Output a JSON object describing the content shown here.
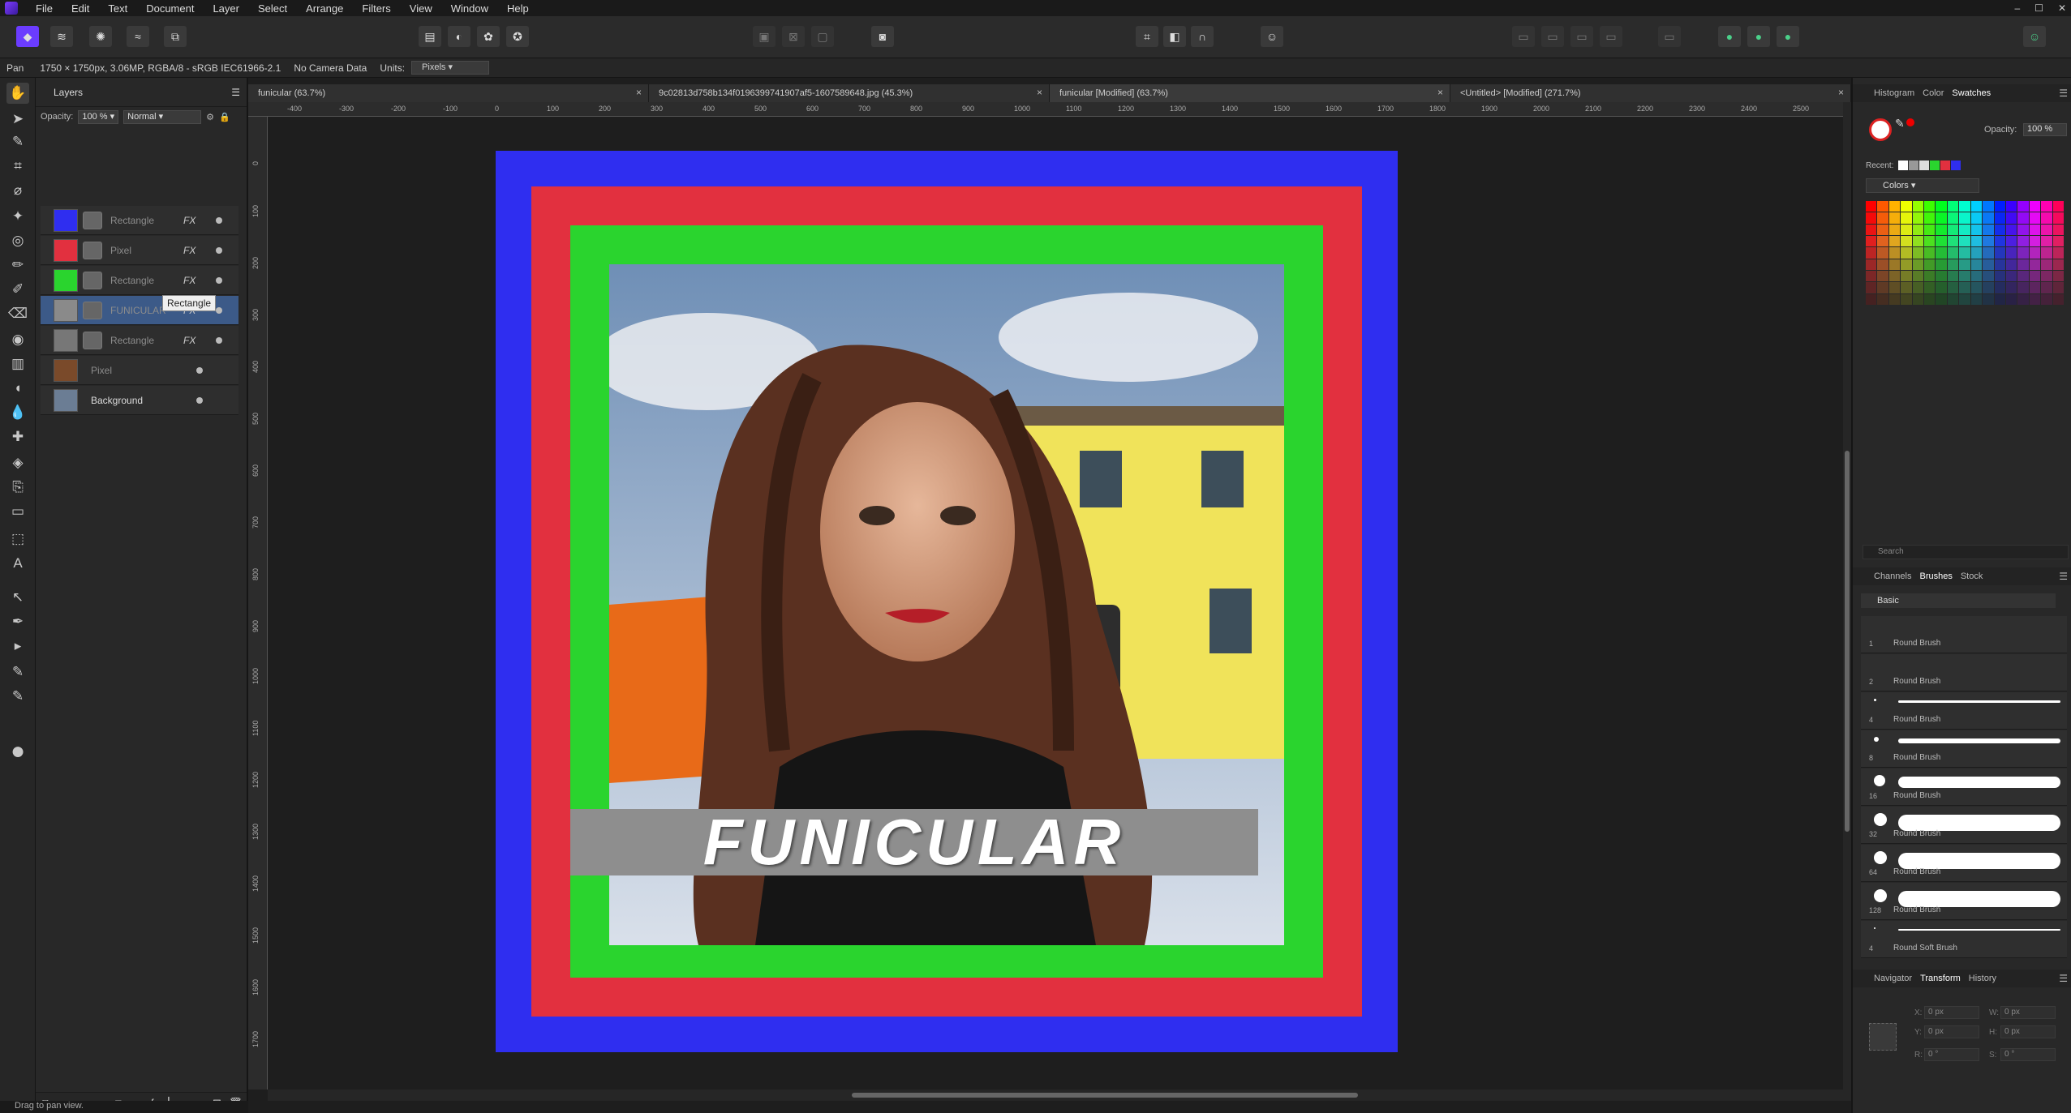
{
  "menubar": {
    "items": [
      "File",
      "Edit",
      "Text",
      "Document",
      "Layer",
      "Select",
      "Arrange",
      "Filters",
      "View",
      "Window",
      "Help"
    ],
    "win_min": "–",
    "win_max": "☐",
    "win_close": "✕"
  },
  "context": {
    "tool": "Pan",
    "info": "1750 × 1750px, 3.06MP, RGBA/8 - sRGB IEC61966-2.1",
    "camera": "No Camera Data",
    "units_label": "Units:",
    "units_value": "Pixels"
  },
  "layers_panel": {
    "title": "Layers",
    "opacity_label": "Opacity:",
    "opacity_value": "100 %",
    "blend_mode": "Normal",
    "rows": [
      {
        "name": "Rectangle",
        "fx": "FX",
        "color": "#2f2ef0"
      },
      {
        "name": "Pixel",
        "fx": "FX",
        "color": "#e2303f"
      },
      {
        "name": "Rectangle",
        "fx": "FX",
        "color": "#2ad42e"
      },
      {
        "name": "FUNICULAR",
        "fx": "FX",
        "color": "#8a8a8a"
      },
      {
        "name": "Rectangle",
        "fx": "FX",
        "color": "#777777"
      },
      {
        "name": "Pixel",
        "fx": "",
        "color": "#7a4a2a"
      },
      {
        "name": "Background",
        "fx": "",
        "color": "#6b7d94"
      }
    ],
    "tooltip": "Rectangle"
  },
  "doc_tabs": [
    {
      "title": "funicular (63.7%)",
      "close": "×"
    },
    {
      "title": "9c02813d758b134f0196399741907af5-1607589648.jpg (45.3%)",
      "close": "×"
    },
    {
      "title": "funicular [Modified] (63.7%)",
      "close": "×"
    },
    {
      "title": "<Untitled> [Modified] (271.7%)",
      "close": "×"
    }
  ],
  "ruler_h": [
    "-400",
    "-300",
    "-200",
    "-100",
    "0",
    "100",
    "200",
    "300",
    "400",
    "500",
    "600",
    "700",
    "800",
    "900",
    "1000",
    "1100",
    "1200",
    "1300",
    "1400",
    "1500",
    "1600",
    "1700",
    "1800",
    "1900",
    "2000",
    "2100",
    "2200",
    "2300",
    "2400",
    "2500"
  ],
  "ruler_v": [
    "0",
    "100",
    "200",
    "300",
    "400",
    "500",
    "600",
    "700",
    "800",
    "900",
    "1000",
    "1100",
    "1200",
    "1300",
    "1400",
    "1500",
    "1600",
    "1700"
  ],
  "canvas": {
    "banner_text": "FUNICULAR",
    "blue": "#2f2ef0",
    "red": "#e2303f",
    "green": "#2ad42e"
  },
  "right_panel": {
    "top_tabs": [
      "Histogram",
      "Color",
      "Swatches"
    ],
    "opacity_label": "Opacity:",
    "opacity_value": "100 %",
    "recent_label": "Recent:",
    "palette_name": "Colors",
    "search_placeholder": "Search",
    "mid_tabs": [
      "Channels",
      "Brushes",
      "Stock"
    ],
    "brush_category": "Basic",
    "brushes": [
      {
        "size": "1",
        "name": "Round Brush"
      },
      {
        "size": "2",
        "name": "Round Brush"
      },
      {
        "size": "4",
        "name": "Round Brush"
      },
      {
        "size": "8",
        "name": "Round Brush"
      },
      {
        "size": "16",
        "name": "Round Brush"
      },
      {
        "size": "32",
        "name": "Round Brush"
      },
      {
        "size": "64",
        "name": "Round Brush"
      },
      {
        "size": "128",
        "name": "Round Brush"
      },
      {
        "size": "4",
        "name": "Round Soft Brush"
      }
    ],
    "bottom_tabs": [
      "Navigator",
      "Transform",
      "History"
    ],
    "transform": {
      "x_label": "X:",
      "x_value": "0 px",
      "y_label": "Y:",
      "y_value": "0 px",
      "w_label": "W:",
      "w_value": "0 px",
      "h_label": "H:",
      "h_value": "0 px",
      "r_label": "R:",
      "r_value": "0 °",
      "s_label": "S:",
      "s_value": "0 °"
    }
  },
  "status": "Drag to pan view."
}
